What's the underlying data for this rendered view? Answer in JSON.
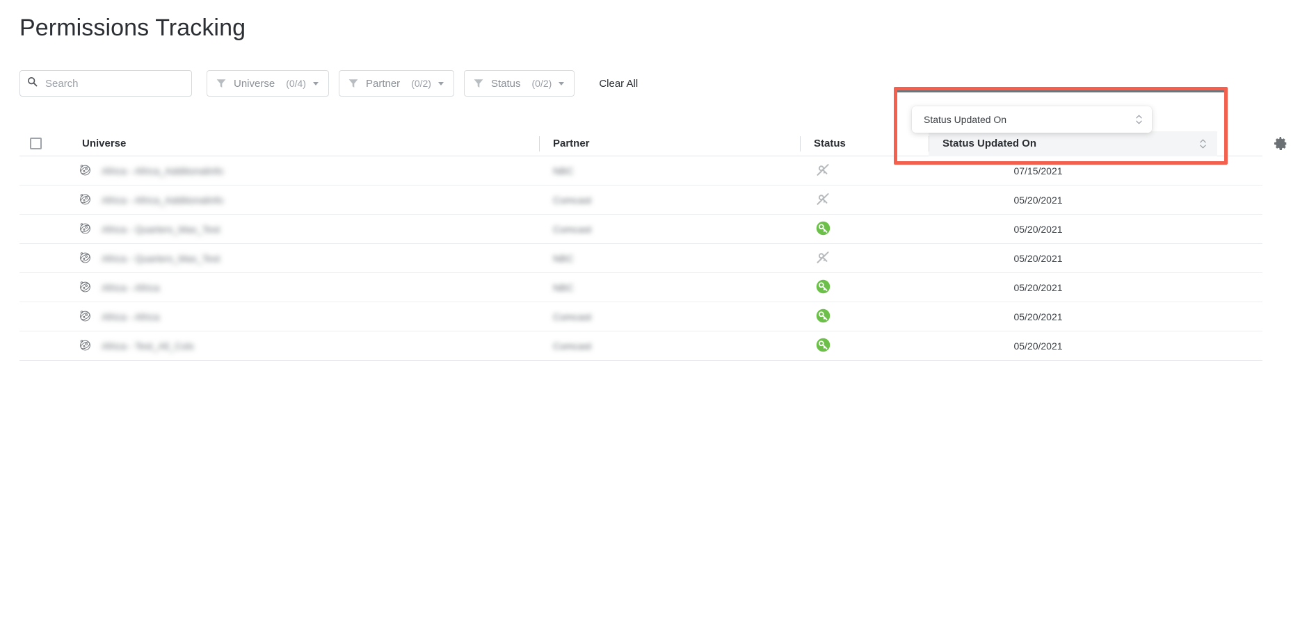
{
  "page": {
    "title": "Permissions Tracking"
  },
  "search": {
    "placeholder": "Search",
    "value": "",
    "icon": "search-icon"
  },
  "filters": [
    {
      "id": "universe",
      "label": "Universe",
      "count": "(0/4)",
      "icon": "funnel-icon",
      "caret": "chevron-down-icon"
    },
    {
      "id": "partner",
      "label": "Partner",
      "count": "(0/2)",
      "icon": "funnel-icon",
      "caret": "chevron-down-icon"
    },
    {
      "id": "status",
      "label": "Status",
      "count": "(0/2)",
      "icon": "funnel-icon",
      "caret": "chevron-down-icon"
    }
  ],
  "clear_all_label": "Clear All",
  "settings_icon": "gear-icon",
  "table": {
    "columns": [
      {
        "key": "select",
        "label": ""
      },
      {
        "key": "universe",
        "label": "Universe"
      },
      {
        "key": "partner",
        "label": "Partner"
      },
      {
        "key": "status",
        "label": "Status"
      },
      {
        "key": "updated",
        "label": "Status Updated On"
      }
    ],
    "select_all_checked": false,
    "sorted_column": "Status Updated On",
    "rows": [
      {
        "universe": "Africa - Africa_Additionalinfo",
        "partner": "NBC",
        "status": "revoked",
        "status_icon": "key-disabled-icon",
        "updated": "07/15/2021"
      },
      {
        "universe": "Africa - Africa_Additionalinfo",
        "partner": "Comcast",
        "status": "revoked",
        "status_icon": "key-disabled-icon",
        "updated": "05/20/2021"
      },
      {
        "universe": "Africa - Quarters_Max_Test",
        "partner": "Comcast",
        "status": "granted",
        "status_icon": "key-active-icon",
        "updated": "05/20/2021"
      },
      {
        "universe": "Africa - Quarters_Max_Test",
        "partner": "NBC",
        "status": "revoked",
        "status_icon": "key-disabled-icon",
        "updated": "05/20/2021"
      },
      {
        "universe": "Africa - Africa",
        "partner": "NBC",
        "status": "granted",
        "status_icon": "key-active-icon",
        "updated": "05/20/2021"
      },
      {
        "universe": "Africa - Africa",
        "partner": "Comcast",
        "status": "granted",
        "status_icon": "key-active-icon",
        "updated": "05/20/2021"
      },
      {
        "universe": "Africa - Test_All_Cols",
        "partner": "Comcast",
        "status": "granted",
        "status_icon": "key-active-icon",
        "updated": "05/20/2021"
      }
    ]
  },
  "floating_dropdown": {
    "selected": "Status Updated On",
    "icon": "sort-chevrons-icon"
  },
  "annotation": {
    "highlight_color": "#f4604e"
  },
  "colors": {
    "status_active": "#6cc04a",
    "status_disabled": "#b6babd",
    "highlight": "#f4604e",
    "header_hover_bg": "#f4f5f6"
  }
}
